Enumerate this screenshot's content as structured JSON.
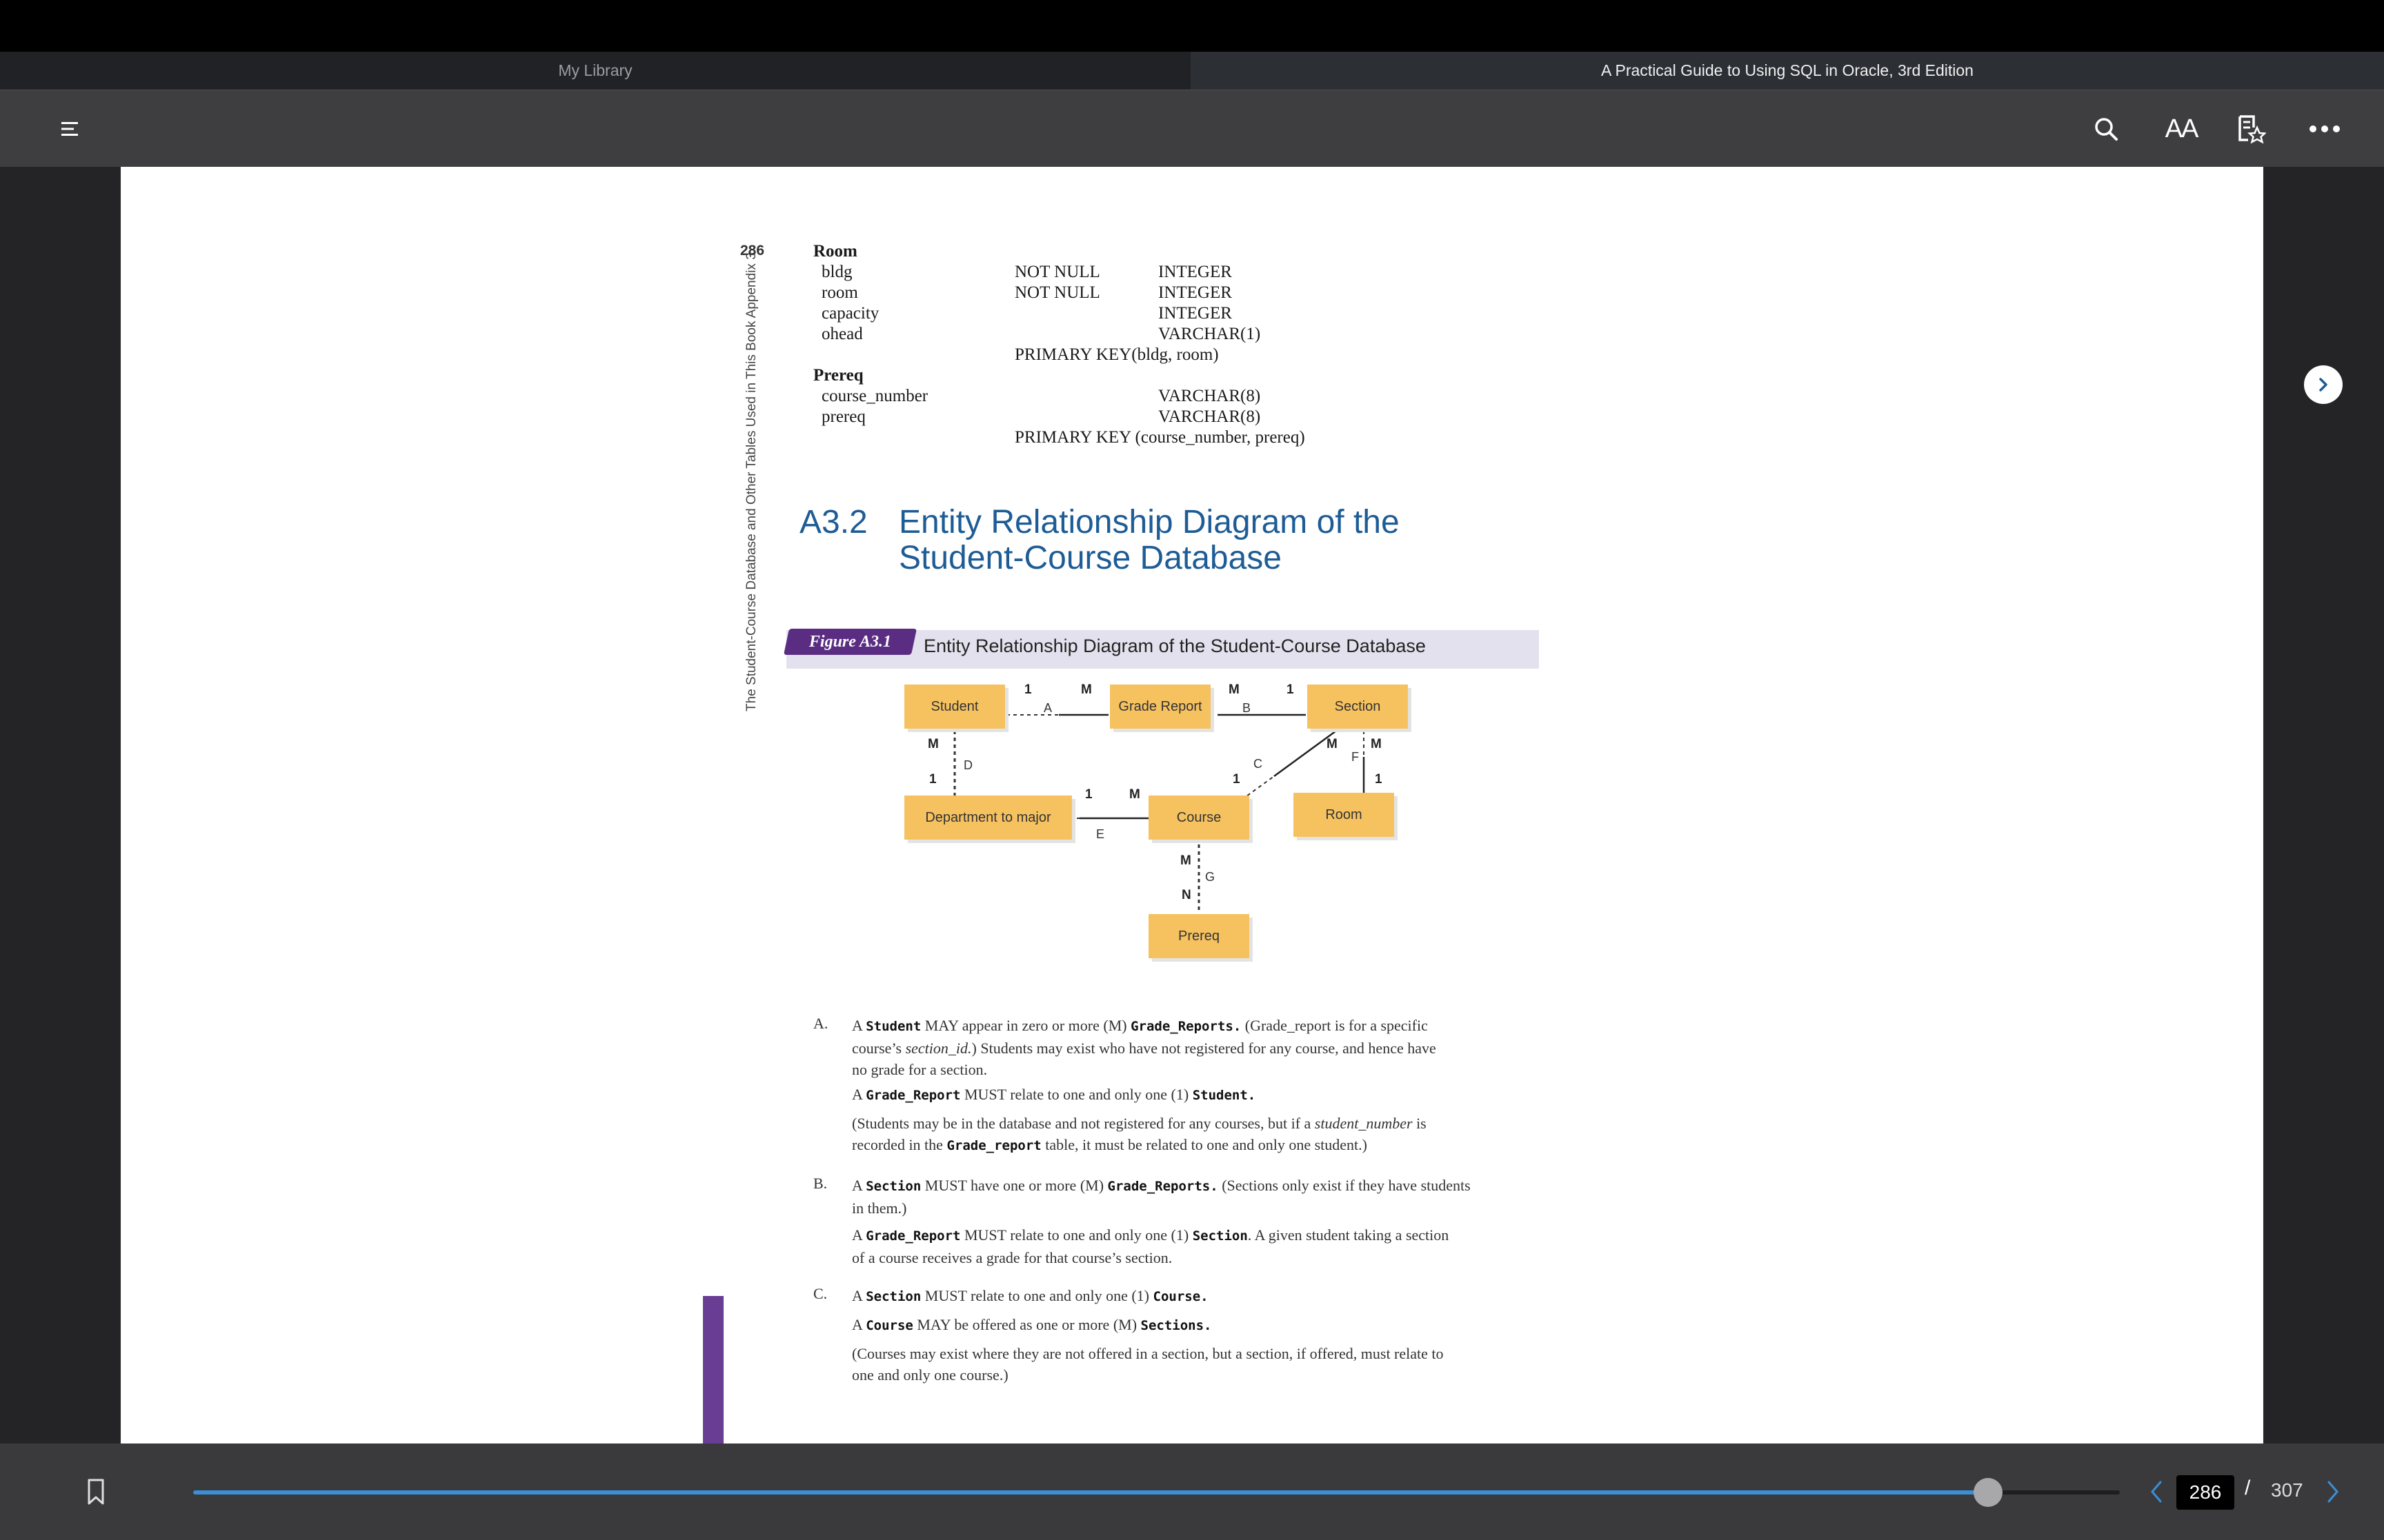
{
  "tabs": [
    {
      "label": "My Library"
    },
    {
      "label": "A Practical Guide to Using SQL in Oracle,  3rd Edition"
    }
  ],
  "toolbar": {
    "icons": [
      "menu-icon",
      "search-icon",
      "font-size-icon",
      "bookmark-list-icon",
      "more-icon"
    ],
    "font_size_label": "AA"
  },
  "page": {
    "page_number": "286",
    "running_head": "The Student-Course Database and Other Tables Used in This Book     Appendix 3",
    "schema": {
      "room": {
        "table": "Room",
        "rows": [
          {
            "col": "bldg",
            "constraint": "NOT NULL",
            "type": "INTEGER"
          },
          {
            "col": "room",
            "constraint": "NOT NULL",
            "type": "INTEGER"
          },
          {
            "col": "capacity",
            "constraint": "",
            "type": "INTEGER"
          },
          {
            "col": "ohead",
            "constraint": "",
            "type": "VARCHAR(1)"
          }
        ],
        "key": "PRIMARY KEY(bldg, room)"
      },
      "prereq": {
        "table": "Prereq",
        "rows": [
          {
            "col": "course_number",
            "constraint": "",
            "type": "VARCHAR(8)"
          },
          {
            "col": "prereq",
            "constraint": "",
            "type": "VARCHAR(8)"
          }
        ],
        "key": "PRIMARY KEY (course_number, prereq)"
      }
    },
    "section": {
      "number": "A3.2",
      "title_line1": "Entity Relationship Diagram of the",
      "title_line2": "Student-Course Database"
    },
    "figure": {
      "tag": "Figure A3.1",
      "caption": "Entity Relationship Diagram of the Student-Course Database",
      "entities": {
        "student": "Student",
        "grade_report": "Grade Report",
        "section": "Section",
        "department": "Department to major",
        "course": "Course",
        "room": "Room",
        "prereq": "Prereq"
      },
      "cardinalities": {
        "a_left": "1",
        "a_right": "M",
        "b_left": "M",
        "b_right": "1",
        "d_top": "M",
        "d_bottom": "1",
        "e_left": "1",
        "e_right": "M",
        "c_top": "M",
        "c_bottom": "1",
        "f_top": "M",
        "f_bottom": "1",
        "g_top": "M",
        "g_bottom": "N"
      },
      "relationship_labels": {
        "a": "A",
        "b": "B",
        "c": "C",
        "d": "D",
        "e": "E",
        "f": "F",
        "g": "G"
      }
    },
    "paragraphs": {
      "a_label": "A.",
      "a1_pre": "A ",
      "a1_ent1": "Student",
      "a1_mid": " MAY appear in zero or more (M) ",
      "a1_ent2": "Grade_Reports.",
      "a1_post": " (Grade_report is for a specific",
      "a1_line2_pre": "course’s ",
      "a1_line2_it": "section_id.",
      "a1_line2_post": ") Students may exist who have not registered for any course, and hence have",
      "a1_line3": "no grade for a section.",
      "a2_pre": "A ",
      "a2_ent1": "Grade_Report",
      "a2_mid": " MUST relate to one and only one (1) ",
      "a2_ent2": "Student.",
      "a3_line1_pre": "(Students may be in the database and not registered for any courses, but if a ",
      "a3_line1_it": "student_number",
      "a3_line1_post": " is",
      "a3_line2_pre": "recorded in the ",
      "a3_line2_ent": "Grade_report",
      "a3_line2_post": " table, it must be related to one and only one student.)",
      "b_label": "B.",
      "b1_pre": "A ",
      "b1_ent1": "Section",
      "b1_mid": " MUST have one or more (M) ",
      "b1_ent2": "Grade_Reports.",
      "b1_post": " (Sections only exist if they have students",
      "b1_line2": "in them.)",
      "b2_pre": "A ",
      "b2_ent1": "Grade_Report",
      "b2_mid": " MUST relate to one and only one (1) ",
      "b2_ent2": "Section",
      "b2_post": ". A given student taking a section",
      "b2_line2": "of a course receives a grade for that course’s section.",
      "c_label": "C.",
      "c1_pre": "A ",
      "c1_ent1": "Section",
      "c1_mid": " MUST relate to one and only one (1) ",
      "c1_ent2": "Course.",
      "c2_pre": "A ",
      "c2_ent1": "Course",
      "c2_mid": " MAY be offered as one or more (M) ",
      "c2_ent2": "Sections.",
      "c3_line1": "(Courses may exist where they are not offered in a section, but a section, if offered, must relate to",
      "c3_line2": "one and only one course.)"
    }
  },
  "navigation": {
    "current_page": "286",
    "separator": "/",
    "total_pages": "307",
    "progress": 0.9315
  },
  "colors": {
    "accent": "#3a8fd6",
    "heading": "#1e5c96",
    "entity_fill": "#f6c260",
    "figure_tag": "#5a2d82"
  }
}
